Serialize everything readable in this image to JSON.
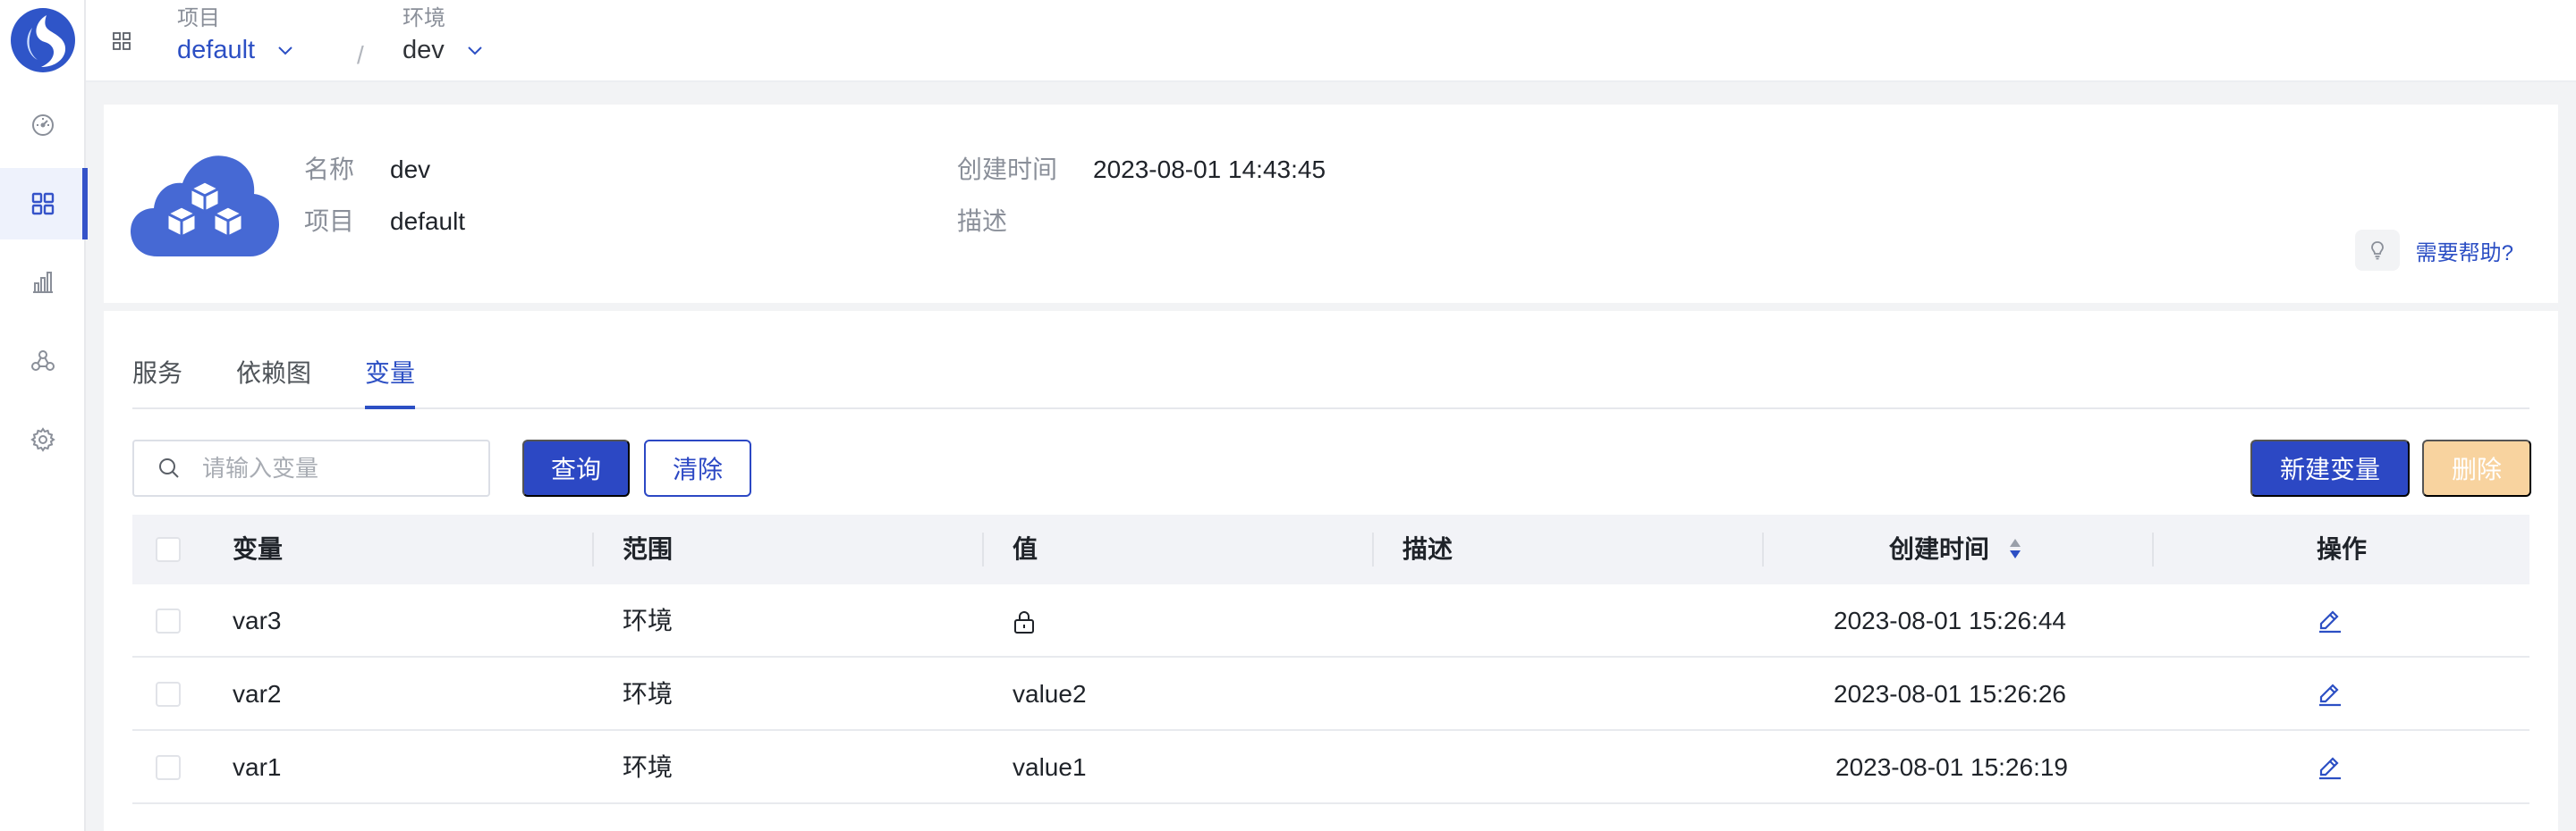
{
  "nav": {
    "items": [
      "dashboard",
      "apps",
      "stats",
      "topology",
      "settings"
    ],
    "active": "apps"
  },
  "breadcrumb": {
    "project_label": "项目",
    "project_value": "default",
    "separator": "/",
    "env_label": "环境",
    "env_value": "dev"
  },
  "info": {
    "name_label": "名称",
    "name_value": "dev",
    "project_label": "项目",
    "project_value": "default",
    "created_label": "创建时间",
    "created_value": "2023-08-01 14:43:45",
    "desc_label": "描述",
    "desc_value": "",
    "help_text": "需要帮助?"
  },
  "tabs": [
    {
      "label": "服务",
      "active": false
    },
    {
      "label": "依赖图",
      "active": false
    },
    {
      "label": "变量",
      "active": true
    }
  ],
  "toolbar": {
    "search_placeholder": "请输入变量",
    "search_value": "",
    "query_label": "查询",
    "clear_label": "清除",
    "new_label": "新建变量",
    "delete_label": "删除"
  },
  "table": {
    "headers": [
      "变量",
      "范围",
      "值",
      "描述",
      "创建时间",
      "操作"
    ],
    "rows": [
      {
        "name": "var3",
        "scope": "环境",
        "value": "",
        "secret": true,
        "desc": "",
        "created": "2023-08-01 15:26:44"
      },
      {
        "name": "var2",
        "scope": "环境",
        "value": "value2",
        "secret": false,
        "desc": "",
        "created": "2023-08-01 15:26:26"
      },
      {
        "name": "var1",
        "scope": "环境",
        "value": "value1",
        "secret": false,
        "desc": "",
        "created": "2023-08-01 15:26:19"
      }
    ]
  },
  "colors": {
    "primary": "#2c48c4",
    "accent_text": "#2c4fc4",
    "delete_disabled": "#f8d39f",
    "page_bg": "#f2f3f5",
    "header_bg": "#f2f3f7"
  }
}
